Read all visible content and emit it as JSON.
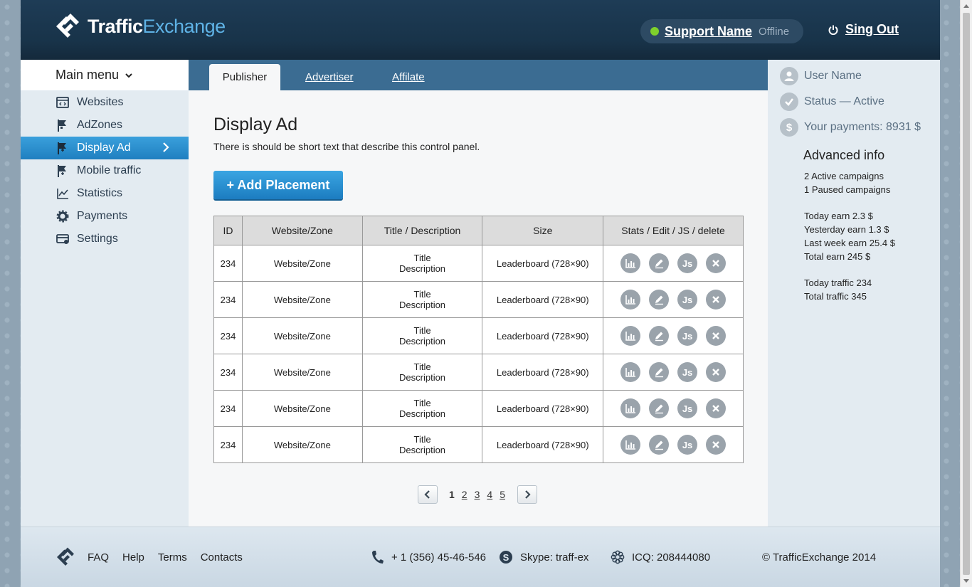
{
  "header": {
    "logo_part1": "Traffic",
    "logo_part2": "Exchange",
    "support_name": "Support Name",
    "support_status": "Offline",
    "signout_label": "Sing Out"
  },
  "sidebar": {
    "menu_title": "Main menu",
    "items": [
      {
        "label": "Websites",
        "icon": "websites-icon"
      },
      {
        "label": "AdZones",
        "icon": "flag-icon"
      },
      {
        "label": "Display Ad",
        "icon": "flag-plus-icon",
        "active": true
      },
      {
        "label": "Mobile traffic",
        "icon": "flag-plus-icon"
      },
      {
        "label": "Statistics",
        "icon": "chart-icon"
      },
      {
        "label": "Payments",
        "icon": "gear-icon"
      },
      {
        "label": "Settings",
        "icon": "card-icon"
      }
    ]
  },
  "tabs": {
    "publisher": "Publisher",
    "advertiser": "Advertiser",
    "affiliate": "Affilate"
  },
  "main": {
    "title": "Display Ad",
    "description": "There is should be short text that describe this control panel.",
    "add_button": "+ Add Placement",
    "table": {
      "headers": [
        "ID",
        "Website/Zone",
        "Title / Description",
        "Size",
        "Stats / Edit / JS / delete"
      ],
      "rows": [
        {
          "id": "234",
          "zone": "Website/Zone",
          "title": "Title",
          "desc": "Description",
          "size": "Leaderboard (728×90)"
        },
        {
          "id": "234",
          "zone": "Website/Zone",
          "title": "Title",
          "desc": "Description",
          "size": "Leaderboard (728×90)"
        },
        {
          "id": "234",
          "zone": "Website/Zone",
          "title": "Title",
          "desc": "Description",
          "size": "Leaderboard (728×90)"
        },
        {
          "id": "234",
          "zone": "Website/Zone",
          "title": "Title",
          "desc": "Description",
          "size": "Leaderboard (728×90)"
        },
        {
          "id": "234",
          "zone": "Website/Zone",
          "title": "Title",
          "desc": "Description",
          "size": "Leaderboard (728×90)"
        },
        {
          "id": "234",
          "zone": "Website/Zone",
          "title": "Title",
          "desc": "Description",
          "size": "Leaderboard (728×90)"
        }
      ],
      "js_label": "Js"
    },
    "pagination": {
      "pages": [
        "1",
        "2",
        "3",
        "4",
        "5"
      ],
      "current": "1"
    }
  },
  "right_panel": {
    "user_name": "User Name",
    "status": "Status — Active",
    "payments": "Your payments: 8931 $",
    "payments_icon_glyph": "$",
    "advanced_title": "Advanced info",
    "campaigns": [
      "2 Active campaigns",
      "1 Paused campaigns"
    ],
    "earnings": [
      "Today earn 2.3 $",
      "Yesterday earn 1.3 $",
      "Last week earn 25.4 $",
      "Total earn 245 $"
    ],
    "traffic": [
      "Today traffic 234",
      "Total traffic 345"
    ]
  },
  "footer": {
    "links": [
      "FAQ",
      "Help",
      "Terms",
      "Contacts"
    ],
    "phone": "+ 1 (356) 45-46-546",
    "skype": "Skype: traff-ex",
    "icq": "ICQ: 208444080",
    "copyright": "© TrafficExchange 2014"
  },
  "colors": {
    "header_bg": "#183349",
    "accent_blue": "#2a8fd0",
    "tabbar_bg": "#3b6c92",
    "online_dot": "#7fd12b",
    "panel_bg": "#e3ebf1"
  }
}
